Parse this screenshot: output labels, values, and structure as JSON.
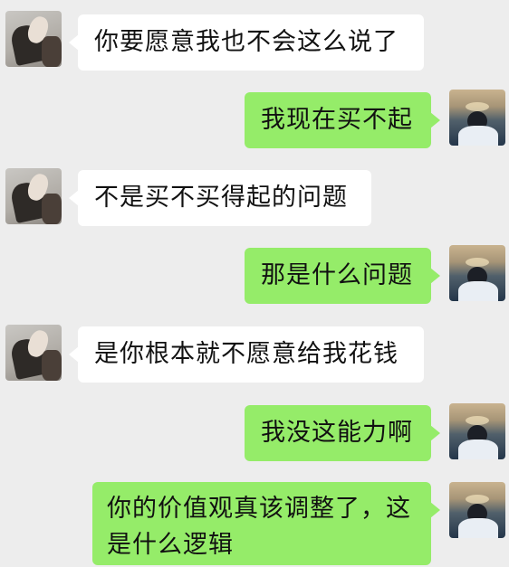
{
  "colors": {
    "background": "#ededed",
    "incoming_bubble": "#ffffff",
    "outgoing_bubble": "#95ec69",
    "text": "#111111"
  },
  "messages": [
    {
      "sender": "other",
      "text": "你要愿意我也不会这么说了"
    },
    {
      "sender": "me",
      "text": "我现在买不起"
    },
    {
      "sender": "other",
      "text": "不是买不买得起的问题"
    },
    {
      "sender": "me",
      "text": "那是什么问题"
    },
    {
      "sender": "other",
      "text": "是你根本就不愿意给我花钱"
    },
    {
      "sender": "me",
      "text": "我没这能力啊"
    },
    {
      "sender": "me",
      "text": "你的价值观真该调整了，这是什么逻辑"
    }
  ]
}
